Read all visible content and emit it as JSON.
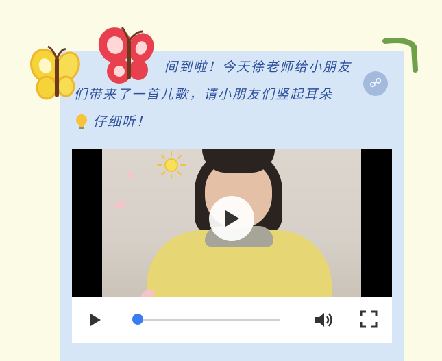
{
  "post": {
    "line1": "间到啦！今天徐老师给小朋友",
    "line2": "们带来了一首儿歌，请小朋友们竖起耳朵",
    "line3": "仔细听！"
  },
  "icons": {
    "bulb": "lightbulb-icon",
    "share": "share-icon",
    "play_overlay": "play-icon",
    "play_control": "play-icon",
    "volume": "volume-icon",
    "fullscreen": "fullscreen-icon",
    "butterfly_yellow": "butterfly-icon",
    "butterfly_red": "butterfly-icon",
    "sun": "sun-icon"
  },
  "video": {
    "progress_fraction": 0.02
  },
  "colors": {
    "background": "#fcfbe6",
    "card": "#d7e6f6",
    "text": "#2d4f9c",
    "seek_accent": "#3b7cf3"
  }
}
